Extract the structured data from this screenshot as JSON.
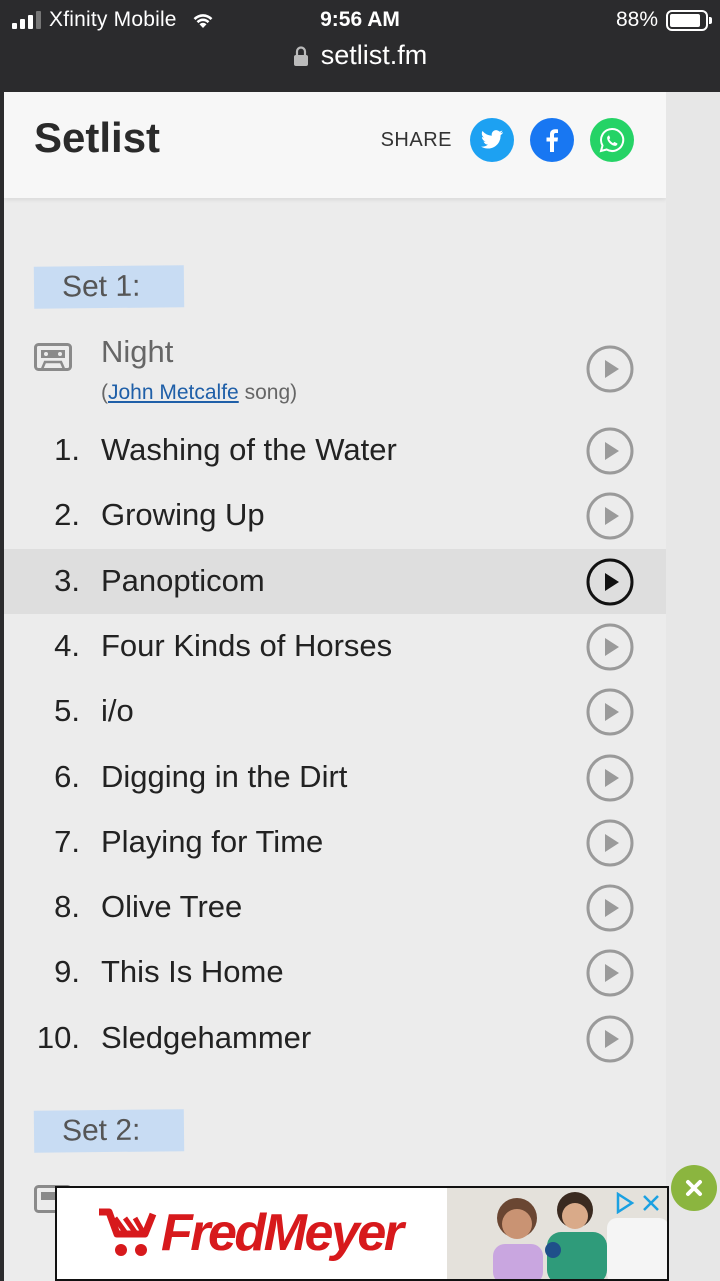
{
  "status_bar": {
    "carrier": "Xfinity Mobile",
    "time": "9:56 AM",
    "battery": "88%",
    "battery_level": 0.88
  },
  "browser": {
    "url": "setlist.fm"
  },
  "header": {
    "title": "Setlist",
    "share_label": "SHARE",
    "social_icons": [
      "twitter-icon",
      "facebook-icon",
      "whatsapp-icon"
    ],
    "colors": {
      "twitter": "#1da1f2",
      "facebook": "#1877f2",
      "whatsapp": "#25d366"
    }
  },
  "set1": {
    "label": "Set 1:",
    "intro": {
      "name": "Night",
      "sub_open": "(",
      "artist": "John Metcalfe",
      "sub_close": " song)"
    },
    "songs": [
      {
        "num": "1.",
        "name": "Washing of the Water"
      },
      {
        "num": "2.",
        "name": "Growing Up"
      },
      {
        "num": "3.",
        "name": "Panopticom"
      },
      {
        "num": "4.",
        "name": "Four Kinds of Horses"
      },
      {
        "num": "5.",
        "name": "i/o"
      },
      {
        "num": "6.",
        "name": "Digging in the Dirt"
      },
      {
        "num": "7.",
        "name": "Playing for Time"
      },
      {
        "num": "8.",
        "name": "Olive Tree"
      },
      {
        "num": "9.",
        "name": "This Is Home"
      },
      {
        "num": "10.",
        "name": "Sledgehammer"
      }
    ],
    "highlighted_index": 2
  },
  "set2": {
    "label": "Set 2:"
  },
  "ad": {
    "brand": "FredMeyer",
    "brand_color": "#d7191c",
    "close_color": "#8bb53f"
  }
}
